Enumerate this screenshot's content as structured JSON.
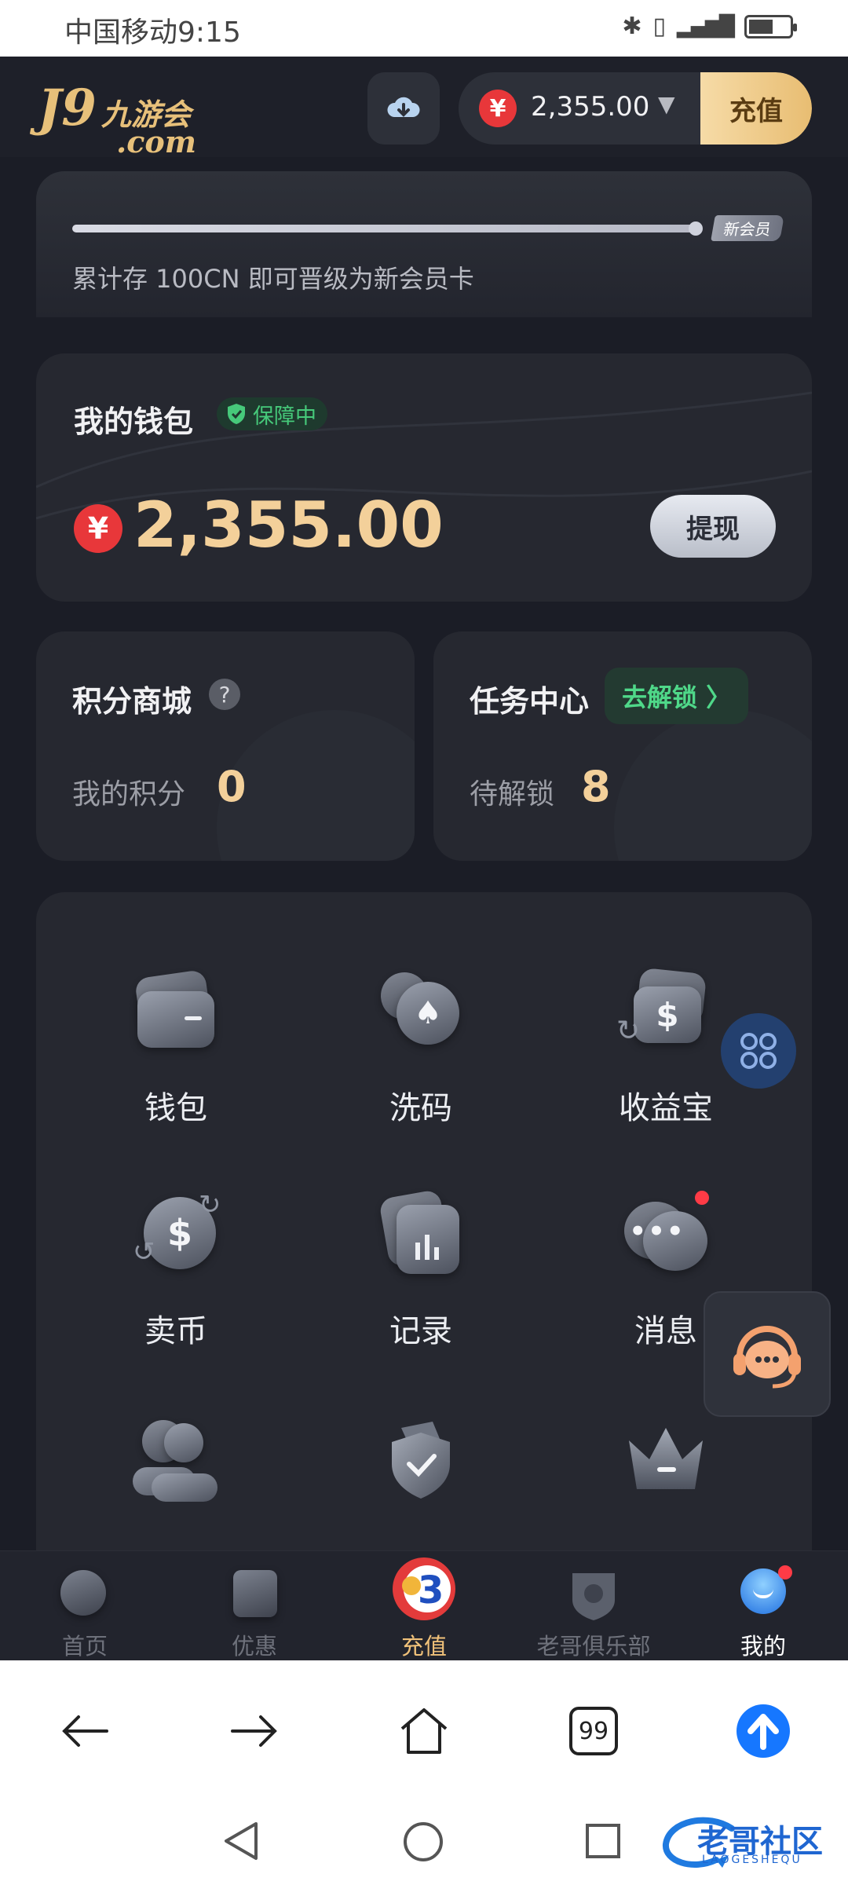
{
  "status_bar": {
    "carrier_time": "中国移动9:15"
  },
  "header": {
    "logo_main": "J9",
    "logo_sub": "九游会",
    "logo_domain": ".com",
    "balance": "2,355.00",
    "recharge_label": "充值"
  },
  "progress": {
    "text": "累计存 100CN 即可晋级为新会员卡",
    "tag": "新会员",
    "fraction": 0.97
  },
  "wallet": {
    "title": "我的钱包",
    "guard_label": "保障中",
    "currency_symbol": "¥",
    "amount": "2,355.00",
    "withdraw_label": "提现"
  },
  "points": {
    "title": "积分商城",
    "label": "我的积分",
    "value": "0"
  },
  "tasks": {
    "title": "任务中心",
    "unlock_label": "去解锁 〉",
    "label": "待解锁",
    "value": "8"
  },
  "menu": [
    {
      "label": "钱包",
      "icon": "wallet-icon"
    },
    {
      "label": "洗码",
      "icon": "chip-icon"
    },
    {
      "label": "收益宝",
      "icon": "earnings-icon"
    },
    {
      "label": "卖币",
      "icon": "sell-coin-icon"
    },
    {
      "label": "记录",
      "icon": "records-icon"
    },
    {
      "label": "消息",
      "icon": "message-icon"
    },
    {
      "label": "",
      "icon": "users-icon"
    },
    {
      "label": "",
      "icon": "shield-check-icon"
    },
    {
      "label": "",
      "icon": "crown-icon"
    }
  ],
  "bottom_nav": [
    {
      "label": "首页",
      "icon": "home-icon"
    },
    {
      "label": "优惠",
      "icon": "gift-icon"
    },
    {
      "label": "充值",
      "icon": "recharge-icon"
    },
    {
      "label": "老哥俱乐部",
      "icon": "club-icon"
    },
    {
      "label": "我的",
      "icon": "profile-icon"
    }
  ],
  "browser": {
    "tabs_count": "99"
  },
  "watermark": {
    "text": "老哥社区",
    "sub": "LAOGESHEQU"
  },
  "colors": {
    "accent_gold": "#f3d09a",
    "badge_red": "#e8373a",
    "green": "#46c97a",
    "bg": "#1b1d26"
  }
}
